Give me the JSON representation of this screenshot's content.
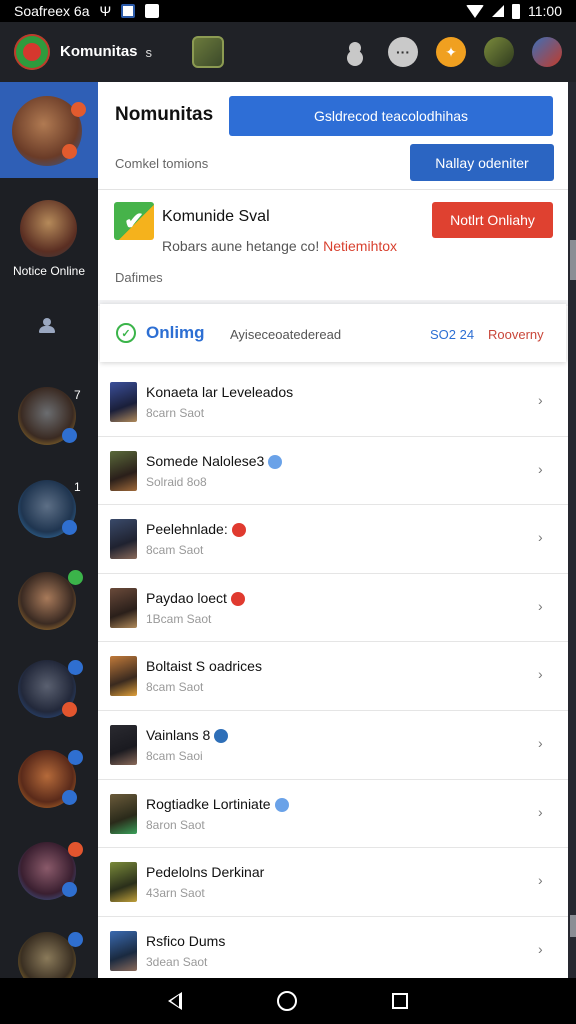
{
  "status_bar": {
    "carrier": "Soafreex 6a",
    "time": "11:00"
  },
  "app_bar": {
    "title": "Komunitas",
    "subtitle": "",
    "chevron": "s"
  },
  "rail": {
    "items": [
      {
        "badge": "",
        "badge_color": "#e25b2e",
        "selected": true
      },
      {
        "label": "Notice Online"
      },
      {
        "badge": "7",
        "badge_color": "#2f6fd0"
      },
      {
        "badge": "1",
        "badge_color": "#2f6fd0"
      },
      {
        "badge": "",
        "badge_color": "#3bb44a"
      },
      {
        "badge": "",
        "badge_color": "#e2552e"
      },
      {
        "badge": "",
        "badge_color": "#2f6fd0"
      },
      {
        "badge": "",
        "badge_color": "#2f6fd0"
      },
      {
        "badge": "",
        "badge_color": "#2f6fd0"
      }
    ]
  },
  "card1": {
    "title": "Nomunitas",
    "primary_button": "Gsldrecod  teacolodhihas",
    "subtitle": "Comkel tomions",
    "secondary_button": "Nallay odeniter"
  },
  "card2": {
    "title": "Komunide Sval",
    "desc_prefix": "Robars aune hetange co! ",
    "desc_highlight": "Netiemihtox",
    "button": "Notlrt Onliahy",
    "footer": "Dafimes"
  },
  "online_bar": {
    "label": "Onlimg",
    "middle": "Ayiseceoatederead",
    "count": "SO2 24",
    "action": "Rooverny"
  },
  "list": [
    {
      "name": "Konaeta lar Leveleados",
      "meta": "8carn Saot",
      "dot": ""
    },
    {
      "name": "Somede Nalolese3",
      "meta": "Solraid 8o8",
      "dot": "#6aa2e8"
    },
    {
      "name": "Peelehnlade:",
      "meta": "8cam Saot",
      "dot": "#e03a2f"
    },
    {
      "name": "Paydao loect",
      "meta": "1Bcam Saot",
      "dot": "#e03a2f"
    },
    {
      "name": "Boltaist S oadrices",
      "meta": "8cam Saot",
      "dot": ""
    },
    {
      "name": "Vainlans 8",
      "meta": "8cam Saoi",
      "dot": "#2e6fb8"
    },
    {
      "name": "Rogtiadke Lortiniate",
      "meta": "8aron Saot",
      "dot": "#6aa2e8"
    },
    {
      "name": "Pedelolns Derkinar",
      "meta": "43arn Saot",
      "dot": ""
    },
    {
      "name": "Rsfico Dums",
      "meta": "3dean Saot",
      "dot": ""
    }
  ],
  "colors": {
    "accent_blue": "#2e6ed6",
    "accent_red": "#df4130",
    "online_green": "#3bb44a",
    "rail_bg": "#1d1f24"
  }
}
